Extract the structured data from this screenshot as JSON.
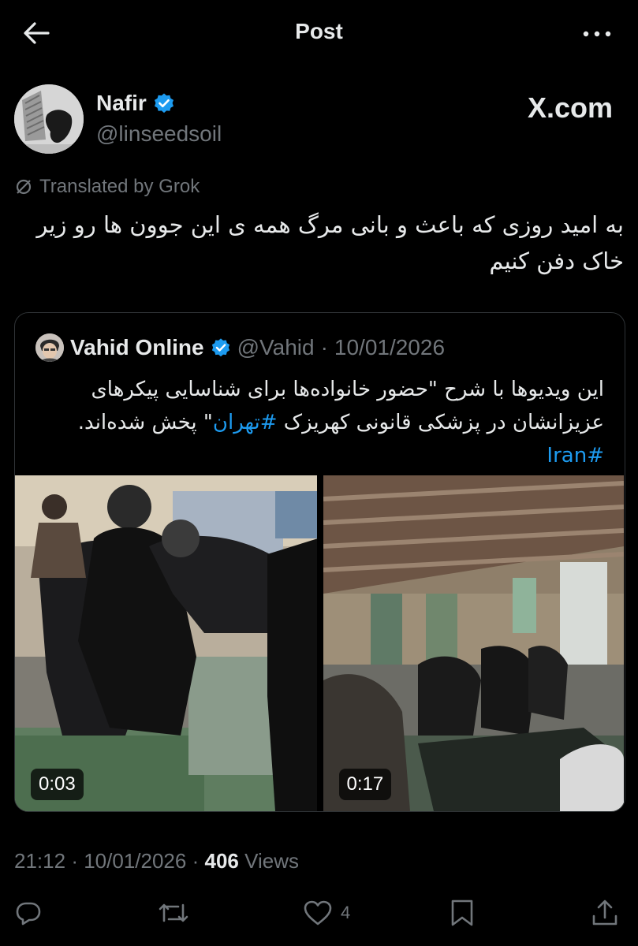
{
  "header": {
    "title": "Post"
  },
  "author": {
    "name": "Nafir",
    "handle": "@linseedsoil",
    "source_brand": "X.com"
  },
  "translation_note": "Translated by Grok",
  "post": {
    "text": "به امید روزی که باعث و بانی مرگ همه ی این جوون ها رو زیر خاک دفن کنیم"
  },
  "quote": {
    "name": "Vahid Online",
    "handle": "@Vahid",
    "separator": "·",
    "date": "10/01/2026",
    "text_before": "این ویدیوها با شرح \"حضور خانواده‌ها برای شناسایی پیکرهای عزیزانشان در پزشکی قانونی کهریزک ",
    "hashtag_tehran": "#تهران",
    "text_after": "\" پخش شده‌اند.",
    "hashtag_iran": "#Iran",
    "videos": [
      {
        "duration": "0:03"
      },
      {
        "duration": "0:17"
      }
    ]
  },
  "meta": {
    "time": "21:12",
    "sep1": "·",
    "date": "10/01/2026",
    "sep2": "·",
    "views_count": "406",
    "views_label": "Views"
  },
  "actions": {
    "like_count": "4"
  },
  "colors": {
    "background": "#000000",
    "text": "#e7e9ea",
    "muted": "#71767b",
    "accent": "#1d9bf0",
    "border": "#2f3336"
  }
}
